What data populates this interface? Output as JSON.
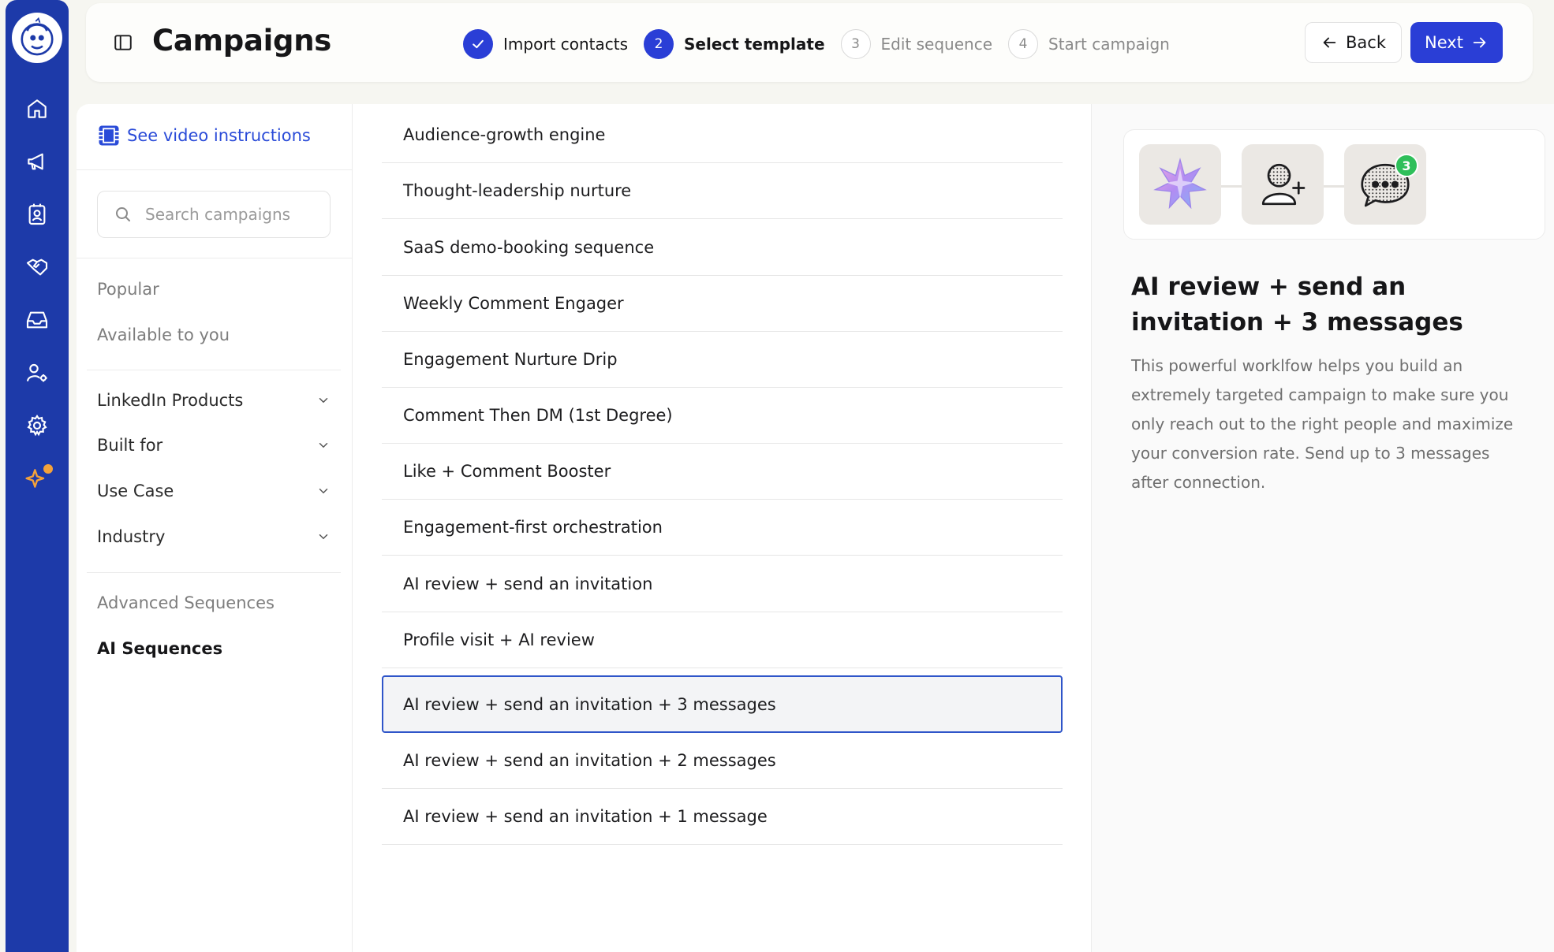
{
  "rail": {
    "items": [
      {
        "name": "home-icon"
      },
      {
        "name": "megaphone-icon"
      },
      {
        "name": "contact-card-icon"
      },
      {
        "name": "handshake-icon"
      },
      {
        "name": "inbox-icon"
      },
      {
        "name": "user-settings-icon"
      },
      {
        "name": "gear-icon"
      },
      {
        "name": "sparkle-icon",
        "has_notification": true
      }
    ],
    "accent": "#1d3aa9",
    "notification_color": "#f4a23a"
  },
  "header": {
    "title": "Campaigns",
    "steps": [
      {
        "number": "1",
        "label": "Import contacts",
        "state": "done"
      },
      {
        "number": "2",
        "label": "Select template",
        "state": "active"
      },
      {
        "number": "3",
        "label": "Edit sequence",
        "state": "todo"
      },
      {
        "number": "4",
        "label": "Start campaign",
        "state": "todo"
      }
    ],
    "back_label": "Back",
    "next_label": "Next",
    "primary_color": "#2a3ed6"
  },
  "filters": {
    "video_link": "See video instructions",
    "search_placeholder": "Search campaigns",
    "quick": [
      "Popular",
      "Available to you"
    ],
    "dropdowns": [
      "LinkedIn Products",
      "Built for",
      "Use Case",
      "Industry"
    ],
    "sections": [
      {
        "label": "Advanced Sequences",
        "selected": false
      },
      {
        "label": "AI Sequences",
        "selected": true
      }
    ]
  },
  "templates": {
    "items": [
      "Audience-growth engine",
      "Thought-leadership nurture",
      "SaaS demo-booking sequence",
      "Weekly Comment Engager",
      "Engagement Nurture Drip",
      "Comment Then DM (1st Degree)",
      "Like + Comment Booster",
      "Engagement-first orchestration",
      "AI review + send an invitation",
      "Profile visit + AI review",
      "AI review + send an invitation + 3 messages",
      "AI review + send an invitation + 2 messages",
      "AI review + send an invitation + 1 message"
    ],
    "selected_index": 10,
    "selected_border_color": "#2f55c9"
  },
  "detail": {
    "flow": [
      {
        "icon": "ai-star-icon"
      },
      {
        "icon": "add-user-icon"
      },
      {
        "icon": "message-bubble-icon",
        "badge": "3"
      }
    ],
    "badge_color": "#2fbf5a",
    "title": "AI review + send an invitation + 3 messages",
    "description": "This powerful worklfow helps you build an extremely targeted campaign to make sure you only reach out to the right people and maximize your conversion rate. Send up to 3 messages after connection."
  }
}
